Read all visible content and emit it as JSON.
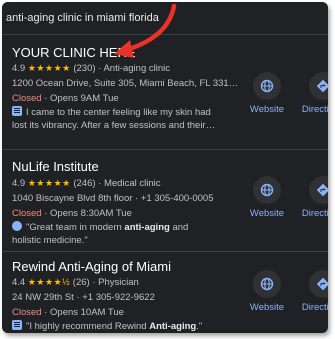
{
  "search": {
    "query": "anti-aging clinic in miami florida"
  },
  "listings": [
    {
      "name": "YOUR CLINIC HERE",
      "rating": "4.9",
      "stars": "★★★★★",
      "reviews": "(230)",
      "category": "· Anti-aging clinic",
      "address": "1200 Ocean Drive, Suite 305, Miami Beach, FL 331…",
      "status": "Closed",
      "hours": "· Opens 9AM Tue",
      "review": "I came to the center feeling like my skin had lost its vibrancy. After a few sessions and their…",
      "actions": [
        "Website",
        "Directions"
      ]
    },
    {
      "name": "NuLife Institute",
      "rating": "4.9",
      "stars": "★★★★★",
      "reviews": "(246)",
      "category": "· Medical clinic",
      "address": "1040 Biscayne Blvd 8th floor · +1 305-400-0005",
      "status": "Closed",
      "hours": "· Opens 8:30AM Tue",
      "review_pre": "\"Great team in modern ",
      "review_bold": "anti-aging",
      "review_post": " and holistic medicine.\"",
      "actions": [
        "Website",
        "Directions"
      ]
    },
    {
      "name": "Rewind Anti-Aging of Miami",
      "rating": "4.4",
      "stars": "★★★★½",
      "reviews": "(26)",
      "category": "· Physician",
      "address": "24 NW 29th St · +1 305-922-9622",
      "status": "Closed",
      "hours": "· Opens 10AM Tue",
      "review_pre": "\"I highly recommend Rewind ",
      "review_bold": "Anti-aging",
      "review_post": ".\"",
      "actions": [
        "Website",
        "Directions"
      ]
    }
  ],
  "colors": {
    "background": "#202124",
    "link": "#8ab4f8",
    "closed": "#f28b82",
    "star": "#fbbc04",
    "annotation_arrow": "#e8322a"
  }
}
